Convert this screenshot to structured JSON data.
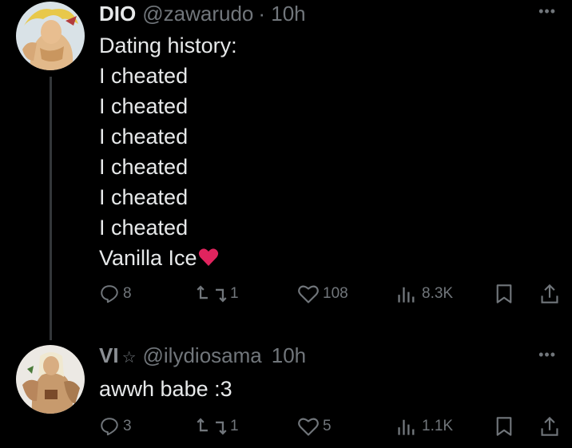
{
  "tweet1": {
    "name": "DIO",
    "handle": "@zawarudo",
    "time": "· 10h",
    "lines": [
      "Dating history:",
      "I cheated",
      "I cheated",
      "I cheated",
      "I cheated",
      "I cheated",
      "I cheated",
      "Vanilla Ice"
    ],
    "emoji": "red-heart",
    "replies": "8",
    "retweets": "1",
    "likes": "108",
    "views": "8.3K"
  },
  "tweet2": {
    "name": "VI",
    "handle": "@ilydiosama",
    "time": "10h",
    "text": "awwh babe :3",
    "replies": "3",
    "retweets": "1",
    "likes": "5",
    "views": "1.1K"
  },
  "colors": {
    "background": "#000000",
    "text": "#e7e9ea",
    "muted": "#71767b",
    "line": "#333639",
    "heart": "#e0245e"
  }
}
